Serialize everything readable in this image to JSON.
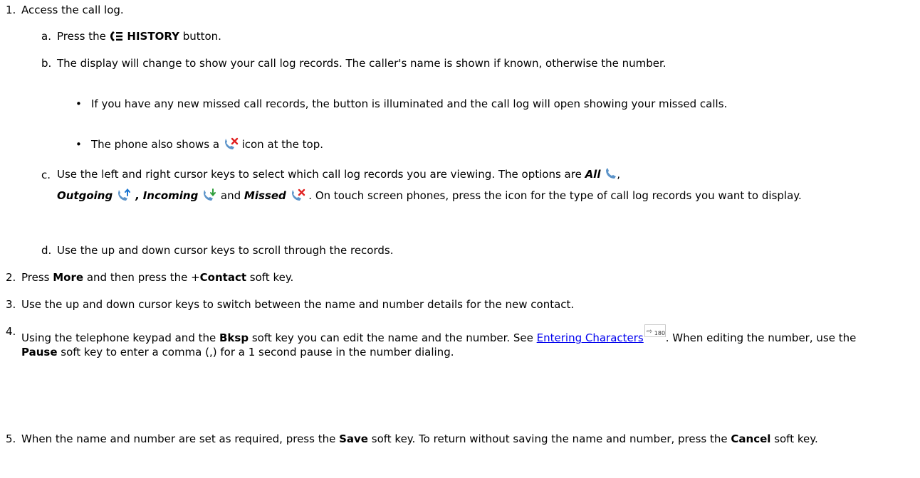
{
  "steps": {
    "s1": {
      "num": "1.",
      "text": "Access the call log."
    },
    "s1a": {
      "num": "a.",
      "pre": "Press the ",
      "btn": "HISTORY",
      "post": " button."
    },
    "s1b": {
      "num": "b.",
      "text": "The display will change to show your call log records. The caller's name is shown if known, otherwise the number."
    },
    "s1b_b1": {
      "text": "If you have any new missed call records, the button is illuminated and the call log will open showing your missed calls."
    },
    "s1b_b2": {
      "pre": "The phone also shows a ",
      "post": " icon at the top."
    },
    "s1c": {
      "num": "c.",
      "t1": "Use the left and right cursor keys to select which call log records you are viewing. The options are ",
      "all": "All",
      "comma1": ",",
      "outgoing": "Outgoing",
      "comma2": " ,",
      "incoming": "Incoming",
      "and": " and ",
      "missed": "Missed",
      "t2": " . On touch screen phones, press the icon for the type of call log records you want to display."
    },
    "s1d": {
      "num": "d.",
      "text": "Use the up and down cursor keys to scroll through the records."
    },
    "s2": {
      "num": "2.",
      "pre": "Press ",
      "more": "More",
      "mid": " and then press the +",
      "contact": "Contact",
      "post": " soft key."
    },
    "s3": {
      "num": "3.",
      "text": "Use the up and down cursor keys to switch between the name and number details for the new contact."
    },
    "s4": {
      "num": "4.",
      "pre": "Using the telephone keypad and the ",
      "bksp": "Bksp",
      "mid": " soft key you can edit the name and the number. See ",
      "link": "Entering Characters",
      "ref_page": "180",
      "mid2": ". When editing the number, use the ",
      "pause": "Pause",
      "post": " soft key to enter a comma (,) for a 1 second pause in the number dialing."
    },
    "s5": {
      "num": "5.",
      "pre": "When the name and number are set as required, press the ",
      "save": "Save",
      "mid": " soft key. To return without saving the name and number, press the ",
      "cancel": "Cancel",
      "post": " soft key."
    }
  },
  "icons": {
    "history": "history-icon",
    "all_calls": "all-calls-phone-icon",
    "outgoing": "outgoing-call-icon",
    "incoming": "incoming-call-icon",
    "missed": "missed-call-icon",
    "xref": "page-reference-icon"
  },
  "colors": {
    "text": "#000000",
    "link": "#0000ee",
    "phone_icon": "#5b93c9",
    "outgoing_arrow": "#1a75d1",
    "incoming_arrow": "#2e9e3a",
    "missed_x": "#e02020"
  }
}
